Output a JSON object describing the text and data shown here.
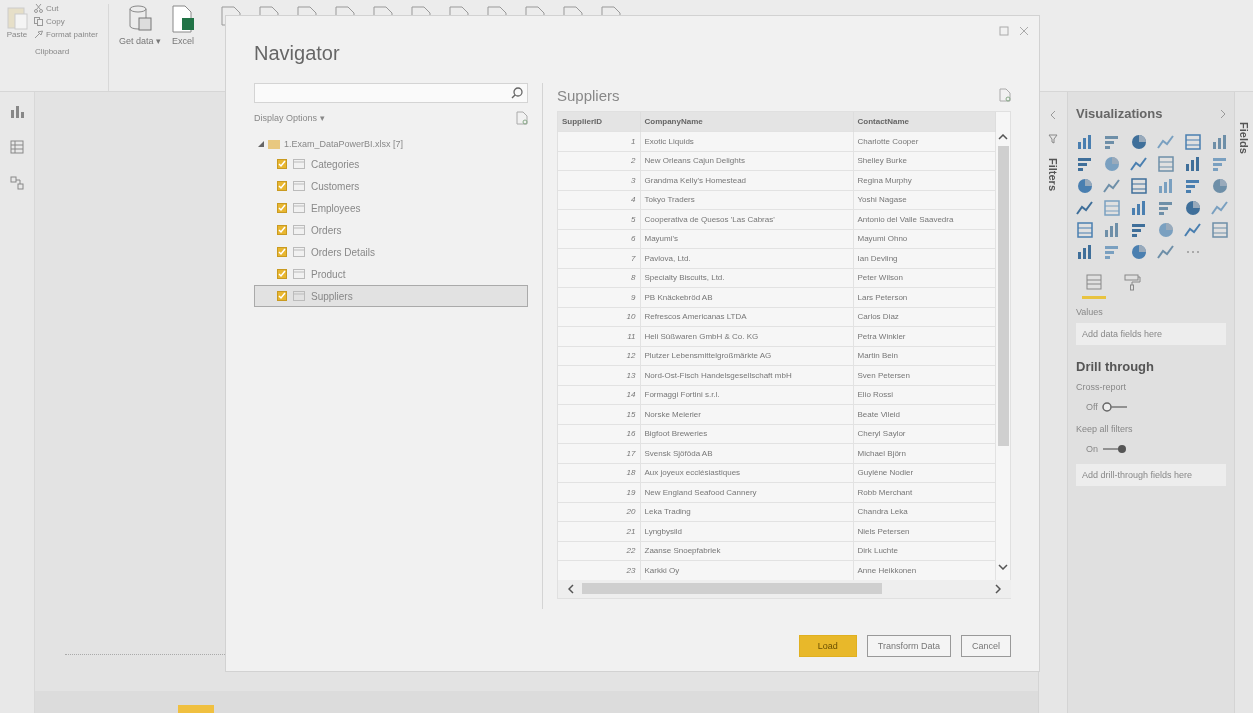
{
  "ribbon": {
    "clipboard": {
      "paste": "Paste",
      "cut": "Cut",
      "copy": "Copy",
      "format_painter": "Format painter",
      "group_label": "Clipboard"
    },
    "get_data": "Get data ▾",
    "excel": "Excel"
  },
  "navigator": {
    "title": "Navigator",
    "display_options": "Display Options ▾",
    "tree": {
      "label": "1.Exam_DataPowerBI.xlsx [7]",
      "expanded": true,
      "children": [
        {
          "label": "Categories",
          "checked": true,
          "selected": false
        },
        {
          "label": "Customers",
          "checked": true,
          "selected": false
        },
        {
          "label": "Employees",
          "checked": true,
          "selected": false
        },
        {
          "label": "Orders",
          "checked": true,
          "selected": false
        },
        {
          "label": "Orders Details",
          "checked": true,
          "selected": false
        },
        {
          "label": "Product",
          "checked": true,
          "selected": false
        },
        {
          "label": "Suppliers",
          "checked": true,
          "selected": true
        }
      ]
    },
    "preview": {
      "title": "Suppliers",
      "table": {
        "columns": [
          "SupplierID",
          "CompanyName",
          "ContactName"
        ],
        "rows": [
          [
            "1",
            "Exotic Liquids",
            "Charlotte Cooper"
          ],
          [
            "2",
            "New Orleans Cajun Delights",
            "Shelley Burke"
          ],
          [
            "3",
            "Grandma Kelly's Homestead",
            "Regina Murphy"
          ],
          [
            "4",
            "Tokyo Traders",
            "Yoshi Nagase"
          ],
          [
            "5",
            "Cooperativa de Quesos 'Las Cabras'",
            "Antonio del Valle Saavedra"
          ],
          [
            "6",
            "Mayumi's",
            "Mayumi Ohno"
          ],
          [
            "7",
            "Pavlova, Ltd.",
            "Ian Devling"
          ],
          [
            "8",
            "Specialty Biscuits, Ltd.",
            "Peter Wilson"
          ],
          [
            "9",
            "PB Knäckebröd AB",
            "Lars Peterson"
          ],
          [
            "10",
            "Refrescos Americanas LTDA",
            "Carlos Diaz"
          ],
          [
            "11",
            "Heli Süßwaren GmbH & Co. KG",
            "Petra Winkler"
          ],
          [
            "12",
            "Plutzer Lebensmittelgroßmärkte AG",
            "Martin Bein"
          ],
          [
            "13",
            "Nord-Ost-Fisch Handelsgesellschaft mbH",
            "Sven Petersen"
          ],
          [
            "14",
            "Formaggi Fortini s.r.l.",
            "Elio Rossi"
          ],
          [
            "15",
            "Norske Meierier",
            "Beate Vileid"
          ],
          [
            "16",
            "Bigfoot Breweries",
            "Cheryl Saylor"
          ],
          [
            "17",
            "Svensk Sjöföda AB",
            "Michael Björn"
          ],
          [
            "18",
            "Aux joyeux ecclésiastiques",
            "Guylène Nodier"
          ],
          [
            "19",
            "New England Seafood Cannery",
            "Robb Merchant"
          ],
          [
            "20",
            "Leka Trading",
            "Chandra Leka"
          ],
          [
            "21",
            "Lyngbysild",
            "Niels Petersen"
          ],
          [
            "22",
            "Zaanse Snoepfabriek",
            "Dirk Luchte"
          ],
          [
            "23",
            "Karkki Oy",
            "Anne Heikkonen"
          ]
        ]
      }
    },
    "buttons": [
      {
        "label": "Load",
        "kind": "primary"
      },
      {
        "label": "Transform Data",
        "kind": "secondary"
      },
      {
        "label": "Cancel",
        "kind": "secondary"
      }
    ]
  },
  "filters_pane": {
    "title": "Filters"
  },
  "visualizations": {
    "title": "Visualizations",
    "pane_tabs": [
      {
        "kind": "fields",
        "selected": true
      },
      {
        "kind": "format",
        "selected": false
      }
    ],
    "values_label": "Values",
    "values_placeholder": "Add data fields here",
    "drill_title": "Drill through",
    "toggles": [
      {
        "label": "Cross-report",
        "state_label": "Off",
        "on": false
      },
      {
        "label": "Keep all filters",
        "state_label": "On",
        "on": true
      }
    ],
    "drill_placeholder": "Add drill-through fields here"
  },
  "fields_pane": {
    "title": "Fields"
  }
}
